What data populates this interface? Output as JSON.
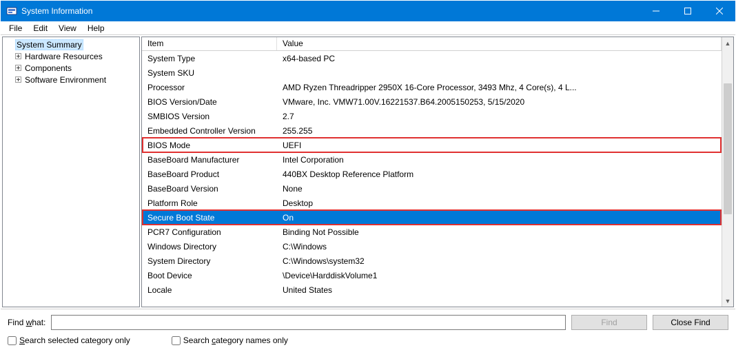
{
  "window": {
    "title": "System Information"
  },
  "menu": {
    "file": "File",
    "edit": "Edit",
    "view": "View",
    "help": "Help"
  },
  "tree": {
    "root": "System Summary",
    "items": [
      "Hardware Resources",
      "Components",
      "Software Environment"
    ]
  },
  "list": {
    "col_item": "Item",
    "col_value": "Value",
    "rows": [
      {
        "item": "System Type",
        "value": "x64-based PC"
      },
      {
        "item": "System SKU",
        "value": ""
      },
      {
        "item": "Processor",
        "value": "AMD Ryzen Threadripper 2950X 16-Core Processor, 3493 Mhz, 4 Core(s), 4 L..."
      },
      {
        "item": "BIOS Version/Date",
        "value": "VMware, Inc. VMW71.00V.16221537.B64.2005150253, 5/15/2020"
      },
      {
        "item": "SMBIOS Version",
        "value": "2.7"
      },
      {
        "item": "Embedded Controller Version",
        "value": "255.255"
      },
      {
        "item": "BIOS Mode",
        "value": "UEFI"
      },
      {
        "item": "BaseBoard Manufacturer",
        "value": "Intel Corporation"
      },
      {
        "item": "BaseBoard Product",
        "value": "440BX Desktop Reference Platform"
      },
      {
        "item": "BaseBoard Version",
        "value": "None"
      },
      {
        "item": "Platform Role",
        "value": "Desktop"
      },
      {
        "item": "Secure Boot State",
        "value": "On"
      },
      {
        "item": "PCR7 Configuration",
        "value": "Binding Not Possible"
      },
      {
        "item": "Windows Directory",
        "value": "C:\\Windows"
      },
      {
        "item": "System Directory",
        "value": "C:\\Windows\\system32"
      },
      {
        "item": "Boot Device",
        "value": "\\Device\\HarddiskVolume1"
      },
      {
        "item": "Locale",
        "value": "United States"
      }
    ],
    "selected_index": 11,
    "highlight_indices": [
      6,
      11
    ]
  },
  "find": {
    "label_prefix": "Find ",
    "label_ul": "w",
    "label_suffix": "hat:",
    "value": "",
    "find_btn": "Find",
    "close_btn": "Close Find",
    "chk1_ul": "S",
    "chk1_rest": "earch selected category only",
    "chk2_prefix": "Search ",
    "chk2_ul": "c",
    "chk2_rest": "ategory names only"
  }
}
